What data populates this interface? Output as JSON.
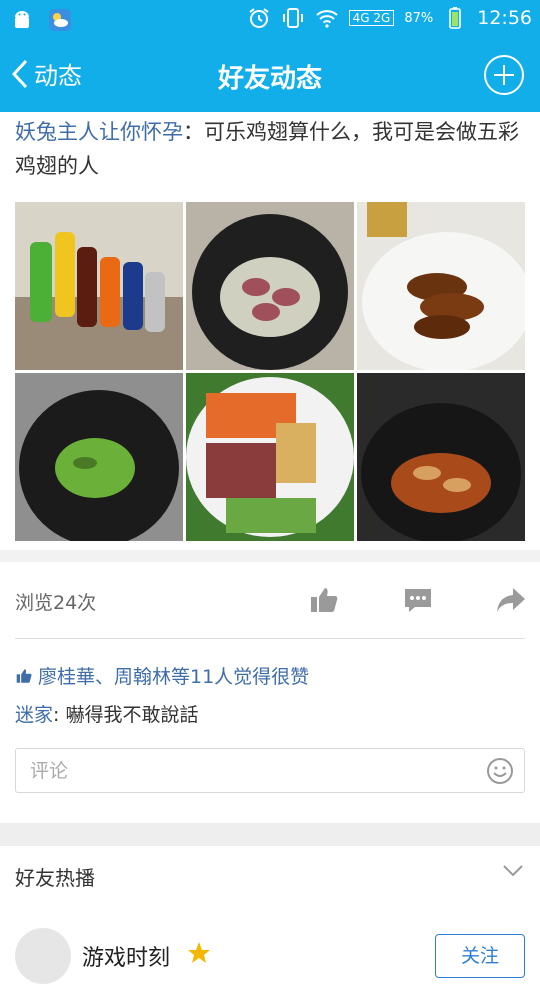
{
  "status_bar": {
    "battery": "87%",
    "time": "12:56",
    "network": "4G 2G"
  },
  "nav": {
    "back_label": "动态",
    "title": "好友动态"
  },
  "post": {
    "author": "妖兔主人让你怀孕",
    "separator": "：",
    "text": "可乐鸡翅算什么，我可是会做五彩鸡翅的人"
  },
  "stats": {
    "views": "浏览24次"
  },
  "likes": {
    "text": "廖桂華、周翰林等11人觉得很赞"
  },
  "comment": {
    "author": "迷家",
    "text": ": 嚇得我不敢說話"
  },
  "comment_input": {
    "placeholder": "评论"
  },
  "hot": {
    "label": "好友热播"
  },
  "recommend": {
    "name": "游戏时刻",
    "follow_label": "关注"
  },
  "colors": {
    "accent": "#12aee9",
    "link": "#3f6da8"
  }
}
